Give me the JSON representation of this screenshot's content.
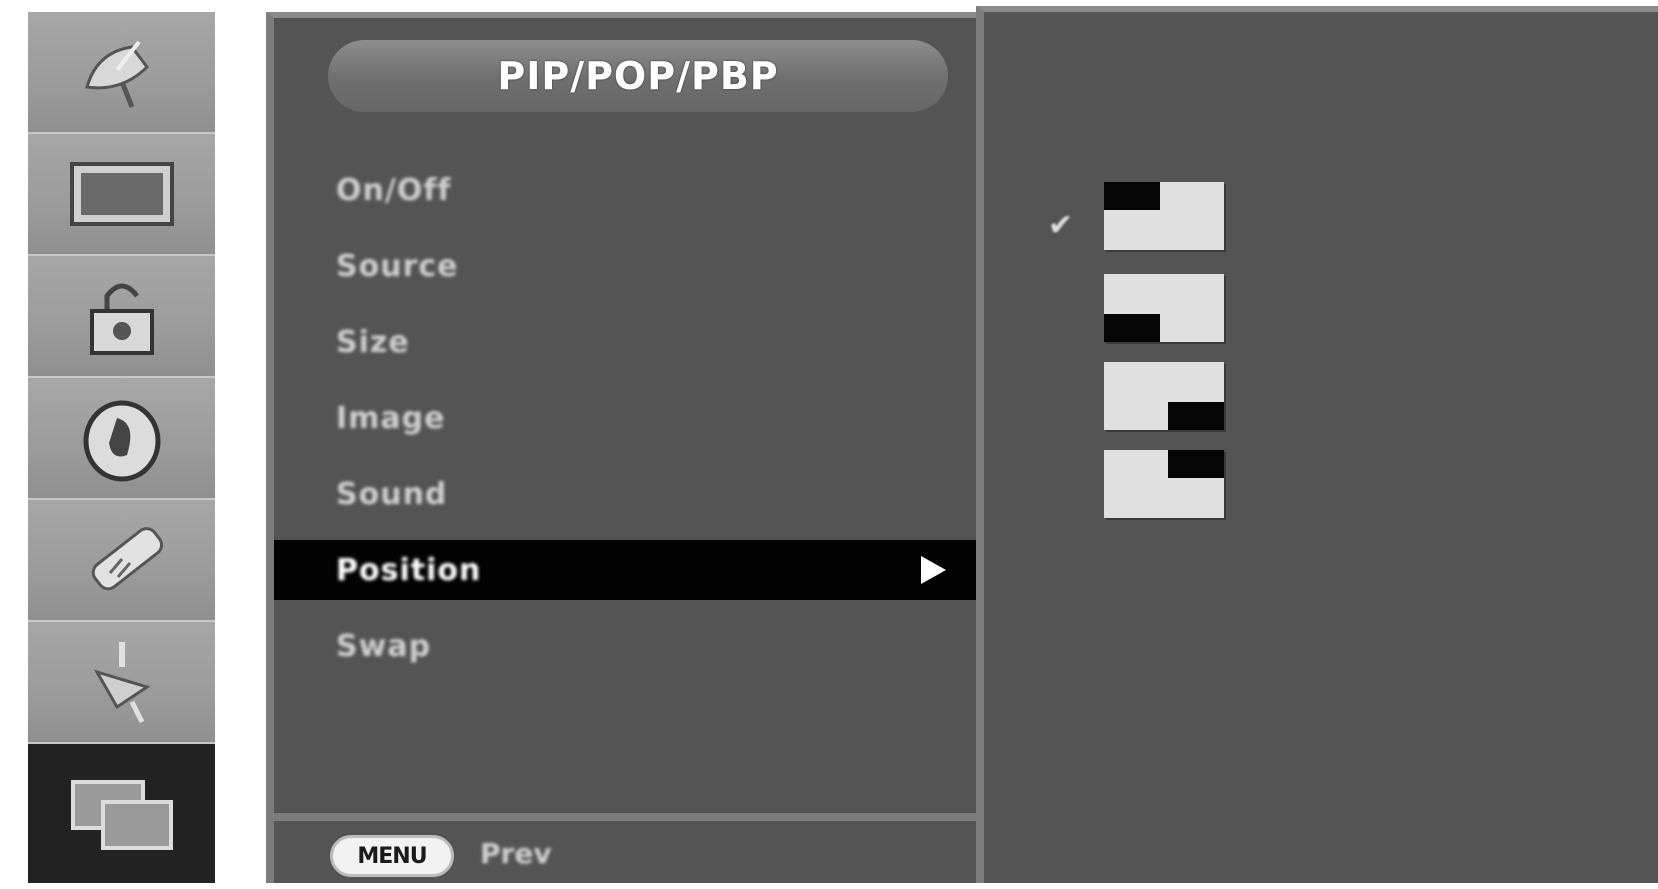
{
  "sidebar": {
    "items": [
      {
        "icon": "satellite-dish-icon"
      },
      {
        "icon": "screen-rectangle-icon"
      },
      {
        "icon": "lock-icon"
      },
      {
        "icon": "color-circle-icon"
      },
      {
        "icon": "remote-control-icon"
      },
      {
        "icon": "connector-plug-icon"
      },
      {
        "icon": "pip-screens-icon",
        "active": true
      }
    ]
  },
  "menu": {
    "title": "PIP/POP/PBP",
    "items": [
      {
        "label": "On/Off"
      },
      {
        "label": "Source"
      },
      {
        "label": "Size"
      },
      {
        "label": "Image"
      },
      {
        "label": "Sound"
      },
      {
        "label": "Position",
        "selected": true
      },
      {
        "label": "Swap"
      }
    ],
    "footer": {
      "key": "MENU",
      "label": "Prev"
    }
  },
  "position_panel": {
    "check_mark": "✔",
    "options": [
      {
        "name": "top-left",
        "selected": true
      },
      {
        "name": "bottom-left"
      },
      {
        "name": "bottom-right"
      },
      {
        "name": "top-right"
      }
    ]
  },
  "colors": {
    "panel_bg": "#545454",
    "selected_bg": "#030303",
    "sidebar_bg": "#9b9b9b",
    "sidebar_active": "#222222"
  }
}
